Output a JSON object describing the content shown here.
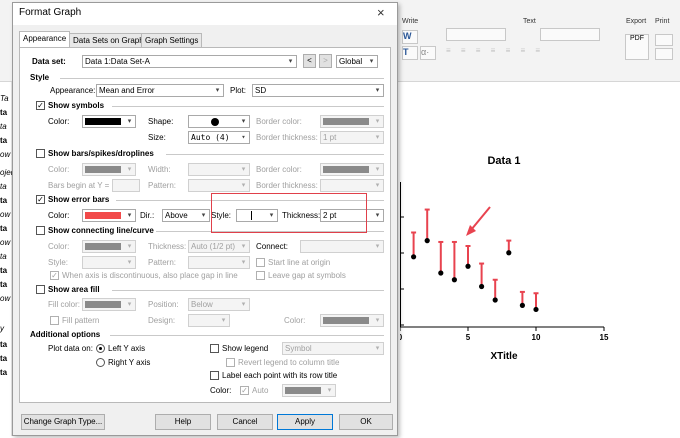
{
  "ribbon": {
    "groups": [
      "Write",
      "Text",
      "Export",
      "Print"
    ],
    "export_label": "PDF"
  },
  "left_pane": {
    "items": [
      "Ta",
      "ta",
      "ta",
      "ta",
      "ow",
      "ojec",
      "ta",
      "ta",
      "ow",
      "ta",
      "ow",
      "ta",
      "ta",
      "ta",
      "ow",
      "y",
      "ta",
      "ta",
      "ta"
    ]
  },
  "plot": {
    "axis_ticks": [
      "0",
      "5",
      "10",
      "15"
    ]
  },
  "chart_data": {
    "type": "scatter",
    "title": "Data 1",
    "xlabel": "XTitle",
    "ylabel": "",
    "xlim": [
      0,
      15
    ],
    "x_ticks": [
      "0",
      "5",
      "10",
      "15"
    ],
    "grid": false,
    "error_bar_direction": "above",
    "marker_color": "#000000",
    "error_bar_color": "#e8434f",
    "points": [
      {
        "x": 1,
        "y": 5.2,
        "err": 1.8
      },
      {
        "x": 2,
        "y": 6.4,
        "err": 2.3
      },
      {
        "x": 3,
        "y": 4.0,
        "err": 2.3
      },
      {
        "x": 4,
        "y": 3.5,
        "err": 2.8
      },
      {
        "x": 5,
        "y": 4.5,
        "err": 1.5
      },
      {
        "x": 6,
        "y": 3.0,
        "err": 1.7
      },
      {
        "x": 7,
        "y": 2.0,
        "err": 1.5
      },
      {
        "x": 8,
        "y": 5.5,
        "err": 0.9
      },
      {
        "x": 9,
        "y": 1.6,
        "err": 1.0
      },
      {
        "x": 10,
        "y": 1.3,
        "err": 1.2
      }
    ],
    "annotations": [
      "red arrow pointing to error bars"
    ]
  },
  "dialog": {
    "title": "Format Graph",
    "close_label": "×",
    "tabs": [
      "Appearance",
      "Data Sets on Graph",
      "Graph Settings"
    ],
    "dataset_label": "Data set:",
    "dataset_value": "Data 1:Data Set-A",
    "nav_prev": "<",
    "nav_next": ">",
    "scope_value": "Global",
    "style_section": "Style",
    "appearance_label": "Appearance:",
    "appearance_value": "Mean and Error",
    "plot_label": "Plot:",
    "plot_value": "SD",
    "show_symbols": "Show symbols",
    "color_label": "Color:",
    "shape_label": "Shape:",
    "size_label": "Size:",
    "size_value": "Auto (4)",
    "border_color_label": "Border color:",
    "border_thickness_label": "Border thickness:",
    "border_thickness_value": "1 pt",
    "show_bars": "Show bars/spikes/droplines",
    "width_label": "Width:",
    "bars_begin_label": "Bars begin at Y =",
    "pattern_label": "Pattern:",
    "show_error_bars": "Show error bars",
    "dir_label": "Dir.:",
    "dir_value": "Above",
    "style_label": "Style:",
    "thickness_label": "Thickness:",
    "thickness_value": "2 pt",
    "show_connecting": "Show connecting line/curve",
    "thickness_auto_value": "Auto (1/2 pt)",
    "connect_label": "Connect:",
    "start_origin": "Start line at origin",
    "discontinuous": "When axis is discontinuous, also place gap in line",
    "leave_gap": "Leave gap at symbols",
    "show_area_fill": "Show area fill",
    "fill_color_label": "Fill color:",
    "position_label": "Position:",
    "position_value": "Below",
    "fill_pattern": "Fill pattern",
    "design_label": "Design:",
    "additional_options": "Additional options",
    "plot_data_on": "Plot data on:",
    "left_y": "Left Y axis",
    "right_y": "Right  Y axis",
    "show_legend": "Show legend",
    "legend_value": "Symbol",
    "revert_legend": "Revert legend to column title",
    "label_each_point": "Label each point with its row title",
    "auto_label": "Auto",
    "change_graph_type": "Change Graph Type...",
    "help": "Help",
    "cancel": "Cancel",
    "apply": "Apply",
    "ok": "OK"
  },
  "colors": {
    "symbol_color": "#000000",
    "error_bar_color": "#f24a4a",
    "disabled_swatch": "#8a8a8a",
    "highlight_box": "#e0404a"
  }
}
